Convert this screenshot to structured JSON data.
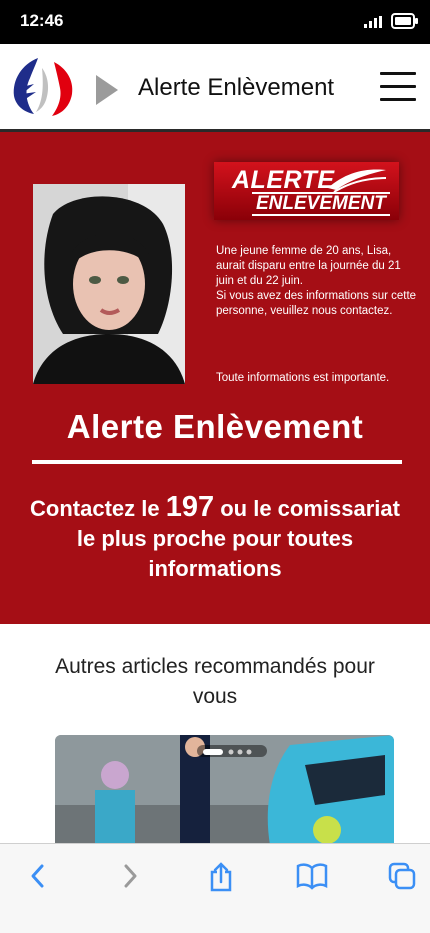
{
  "status": {
    "time": "12:46"
  },
  "header": {
    "title": "Alerte Enlèvement"
  },
  "alert": {
    "badge_line1": "ALERTE",
    "badge_line2": "ENLEVEMENT",
    "description_1": "Une jeune femme de 20 ans, Lisa, aurait disparu entre la journée du 21 juin et du 22 juin.",
    "description_2": "Si vous avez des informations sur cette personne, veuillez nous contactez.",
    "note": "Toute informations est importante.",
    "heading": "Alerte Enlèvement",
    "contact_prefix": "Contactez le ",
    "contact_number": "197",
    "contact_suffix": " ou le comissariat le plus proche pour toutes informations"
  },
  "recommended": {
    "title": "Autres articles recommandés pour vous"
  },
  "colors": {
    "alert_red": "#a50e15",
    "browser_blue": "#3b8ff5"
  }
}
